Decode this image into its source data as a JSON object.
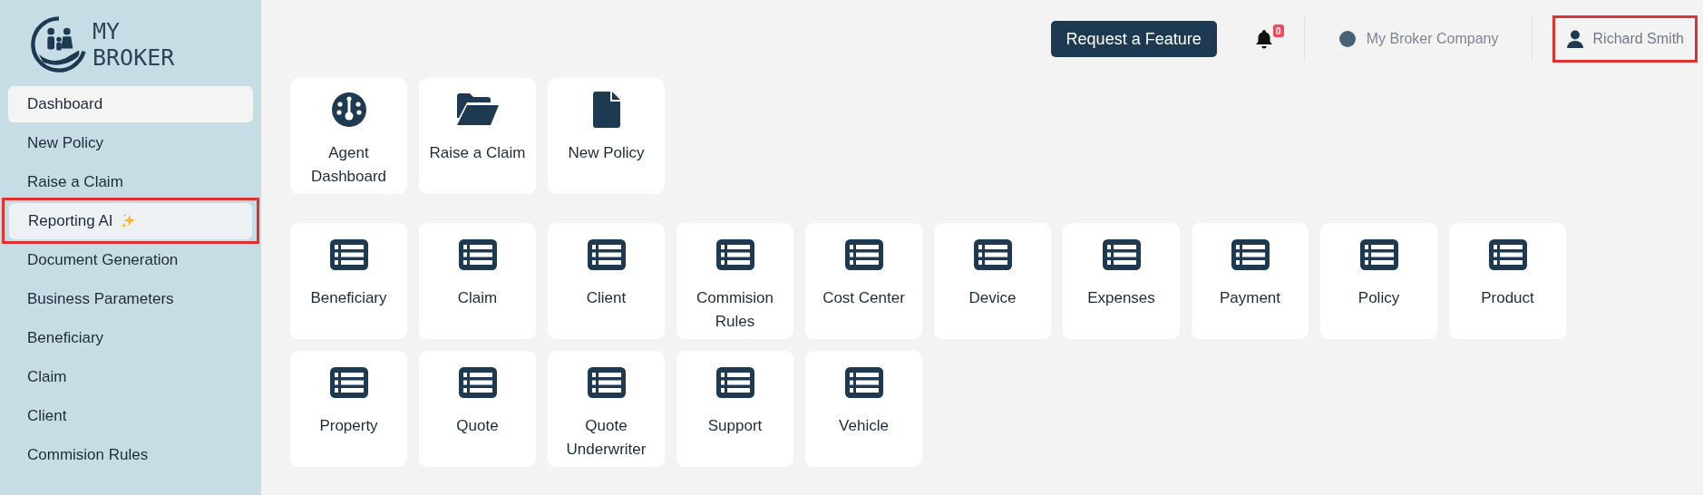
{
  "logo": {
    "line_1": "MY",
    "line_2": "BROKER"
  },
  "sidebar": {
    "items": [
      {
        "label": "Dashboard",
        "kind": "plain",
        "selected": true,
        "hovered": false,
        "outlined": false
      },
      {
        "label": "New Policy",
        "kind": "plain",
        "selected": false,
        "hovered": false,
        "outlined": false
      },
      {
        "label": "Raise a Claim",
        "kind": "plain",
        "selected": false,
        "hovered": false,
        "outlined": false
      },
      {
        "label": "Reporting AI",
        "kind": "sparkle",
        "selected": false,
        "hovered": true,
        "outlined": true
      },
      {
        "label": "Document Generation",
        "kind": "plain",
        "selected": false,
        "hovered": false,
        "outlined": false
      },
      {
        "label": "Business Parameters",
        "kind": "plain",
        "selected": false,
        "hovered": false,
        "outlined": false
      },
      {
        "label": "Beneficiary",
        "kind": "plain",
        "selected": false,
        "hovered": false,
        "outlined": false
      },
      {
        "label": "Claim",
        "kind": "plain",
        "selected": false,
        "hovered": false,
        "outlined": false
      },
      {
        "label": "Client",
        "kind": "plain",
        "selected": false,
        "hovered": false,
        "outlined": false
      },
      {
        "label": "Commision Rules",
        "kind": "plain",
        "selected": false,
        "hovered": false,
        "outlined": false
      }
    ]
  },
  "header": {
    "feature_button": "Request a Feature",
    "notifications": {
      "count": "0"
    },
    "company": {
      "name": "My Broker Company",
      "color": "#4a6278"
    },
    "user": {
      "name": "Richard Smith",
      "outlined": true
    }
  },
  "quick_links": [
    {
      "label": "Agent Dashboard",
      "kind": "gauge"
    },
    {
      "label": "Raise a Claim",
      "kind": "folder"
    },
    {
      "label": "New Policy",
      "kind": "file"
    }
  ],
  "entities": [
    {
      "label": "Beneficiary"
    },
    {
      "label": "Claim"
    },
    {
      "label": "Client"
    },
    {
      "label": "Commision Rules"
    },
    {
      "label": "Cost Center"
    },
    {
      "label": "Device"
    },
    {
      "label": "Expenses"
    },
    {
      "label": "Payment"
    },
    {
      "label": "Policy"
    },
    {
      "label": "Product"
    },
    {
      "label": "Property"
    },
    {
      "label": "Quote"
    },
    {
      "label": "Quote Underwriter"
    },
    {
      "label": "Support"
    },
    {
      "label": "Vehicle"
    }
  ]
}
